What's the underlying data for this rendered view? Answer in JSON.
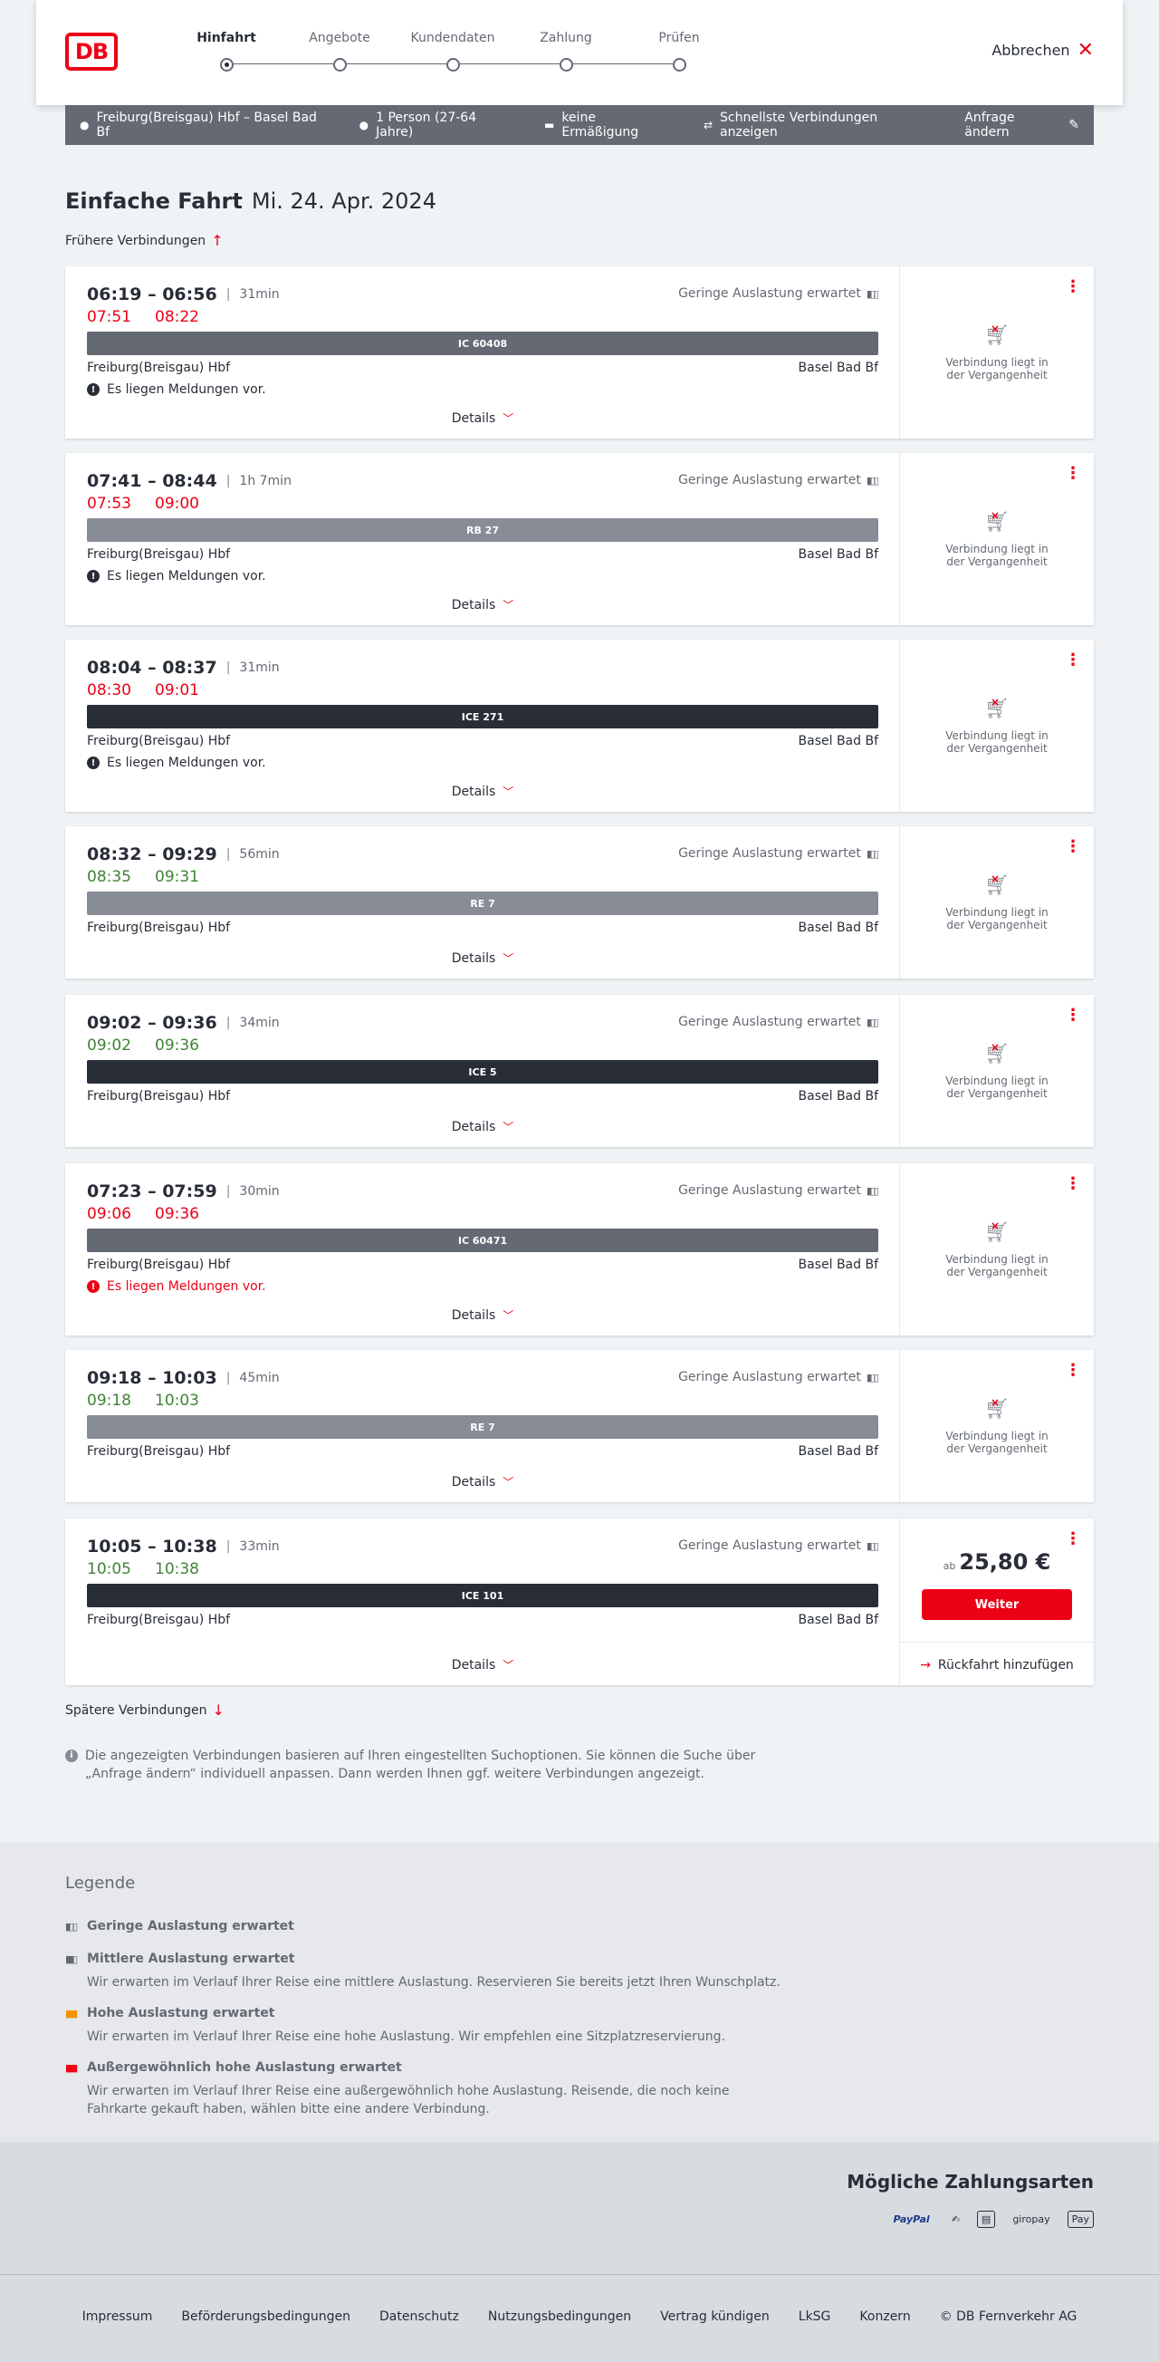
{
  "header": {
    "logo": "DB",
    "steps": [
      "Hinfahrt",
      "Angebote",
      "Kundendaten",
      "Zahlung",
      "Prüfen"
    ],
    "active_step": 0,
    "cancel_label": "Abbrechen"
  },
  "search": {
    "route": "Freiburg(Breisgau) Hbf – Basel Bad Bf",
    "passengers": "1 Person (27-64 Jahre)",
    "discount": "keine Ermäßigung",
    "fastest": "Schnellste Verbindungen anzeigen",
    "change": "Anfrage ändern"
  },
  "title": {
    "main": "Einfache Fahrt",
    "date": "Mi. 24. Apr. 2024"
  },
  "earlier_label": "Frühere Verbindungen",
  "later_label": "Spätere Verbindungen",
  "details_label": "Details",
  "past_label": "Verbindung liegt in der Vergangenheit",
  "connections": [
    {
      "time": "06:19 – 06:56",
      "duration": "31min",
      "occupancy": "Geringe Auslastung erwartet",
      "rt_dep": "07:51",
      "rt_arr": "08:22",
      "rt_status": "late",
      "train": "IC 60408",
      "train_color": "#646973",
      "from": "Freiburg(Breisgau) Hbf",
      "to": "Basel Bad Bf",
      "notice": "Es liegen Meldungen vor.",
      "notice_red": false
    },
    {
      "time": "07:41 – 08:44",
      "duration": "1h 7min",
      "occupancy": "Geringe Auslastung erwartet",
      "rt_dep": "07:53",
      "rt_arr": "09:00",
      "rt_status": "late",
      "train": "RB 27",
      "train_color": "#878c96",
      "from": "Freiburg(Breisgau) Hbf",
      "to": "Basel Bad Bf",
      "notice": "Es liegen Meldungen vor.",
      "notice_red": false
    },
    {
      "time": "08:04 – 08:37",
      "duration": "31min",
      "occupancy": "",
      "rt_dep": "08:30",
      "rt_arr": "09:01",
      "rt_status": "late",
      "train": "ICE 271",
      "train_color": "#282d37",
      "from": "Freiburg(Breisgau) Hbf",
      "to": "Basel Bad Bf",
      "notice": "Es liegen Meldungen vor.",
      "notice_red": false
    },
    {
      "time": "08:32 – 09:29",
      "duration": "56min",
      "occupancy": "Geringe Auslastung erwartet",
      "rt_dep": "08:35",
      "rt_arr": "09:31",
      "rt_status": "ontime",
      "train": "RE 7",
      "train_color": "#878c96",
      "from": "Freiburg(Breisgau) Hbf",
      "to": "Basel Bad Bf",
      "notice": "",
      "notice_red": false
    },
    {
      "time": "09:02 – 09:36",
      "duration": "34min",
      "occupancy": "Geringe Auslastung erwartet",
      "rt_dep": "09:02",
      "rt_arr": "09:36",
      "rt_status": "ontime",
      "train": "ICE 5",
      "train_color": "#282d37",
      "from": "Freiburg(Breisgau) Hbf",
      "to": "Basel Bad Bf",
      "notice": "",
      "notice_red": false
    },
    {
      "time": "07:23 – 07:59",
      "duration": "30min",
      "occupancy": "Geringe Auslastung erwartet",
      "rt_dep": "09:06",
      "rt_arr": "09:36",
      "rt_status": "late",
      "train": "IC 60471",
      "train_color": "#646973",
      "from": "Freiburg(Breisgau) Hbf",
      "to": "Basel Bad Bf",
      "notice": "Es liegen Meldungen vor.",
      "notice_red": true
    },
    {
      "time": "09:18 – 10:03",
      "duration": "45min",
      "occupancy": "Geringe Auslastung erwartet",
      "rt_dep": "09:18",
      "rt_arr": "10:03",
      "rt_status": "ontime",
      "train": "RE 7",
      "train_color": "#878c96",
      "from": "Freiburg(Breisgau) Hbf",
      "to": "Basel Bad Bf",
      "notice": "",
      "notice_red": false
    },
    {
      "time": "10:05 – 10:38",
      "duration": "33min",
      "occupancy": "Geringe Auslastung erwartet",
      "rt_dep": "10:05",
      "rt_arr": "10:38",
      "rt_status": "ontime",
      "train": "ICE 101",
      "train_color": "#282d37",
      "from": "Freiburg(Breisgau) Hbf",
      "to": "Basel Bad Bf",
      "notice": "",
      "notice_red": false,
      "price_prefix": "ab",
      "price": "25,80 €",
      "buy_label": "Weiter",
      "return_label": "Rückfahrt hinzufügen"
    }
  ],
  "info_note": "Die angezeigten Verbindungen basieren auf Ihren eingestellten Suchoptionen. Sie können die Suche über „Anfrage ändern“ individuell anpassen. Dann werden Ihnen ggf. weitere Verbindungen angezeigt.",
  "legend": {
    "title": "Legende",
    "items": [
      {
        "head": "Geringe Auslastung erwartet",
        "desc": "",
        "color": "#646973"
      },
      {
        "head": "Mittlere Auslastung erwartet",
        "desc": "Wir erwarten im Verlauf Ihrer Reise eine mittlere Auslastung. Reservieren Sie bereits jetzt Ihren Wunschplatz.",
        "color": "#646973"
      },
      {
        "head": "Hohe Auslastung erwartet",
        "desc": "Wir erwarten im Verlauf Ihrer Reise eine hohe Auslastung. Wir empfehlen eine Sitzplatzreservierung.",
        "color": "#f39200"
      },
      {
        "head": "Außergewöhnlich hohe Auslastung erwartet",
        "desc": "Wir erwarten im Verlauf Ihrer Reise eine außergewöhnlich hohe Auslastung. Reisende, die noch keine Fahrkarte gekauft haben, wählen bitte eine andere Verbindung.",
        "color": "#ec0016"
      }
    ]
  },
  "payment": {
    "title": "Mögliche Zahlungsarten",
    "methods": [
      "PayPal",
      "Kreditkarte",
      "Lastschrift",
      "giropay",
      "Apple Pay"
    ]
  },
  "footer": {
    "links": [
      "Impressum",
      "Beförderungsbedingungen",
      "Datenschutz",
      "Nutzungsbedingungen",
      "Vertrag kündigen",
      "LkSG",
      "Konzern",
      "© DB Fernverkehr AG"
    ]
  }
}
